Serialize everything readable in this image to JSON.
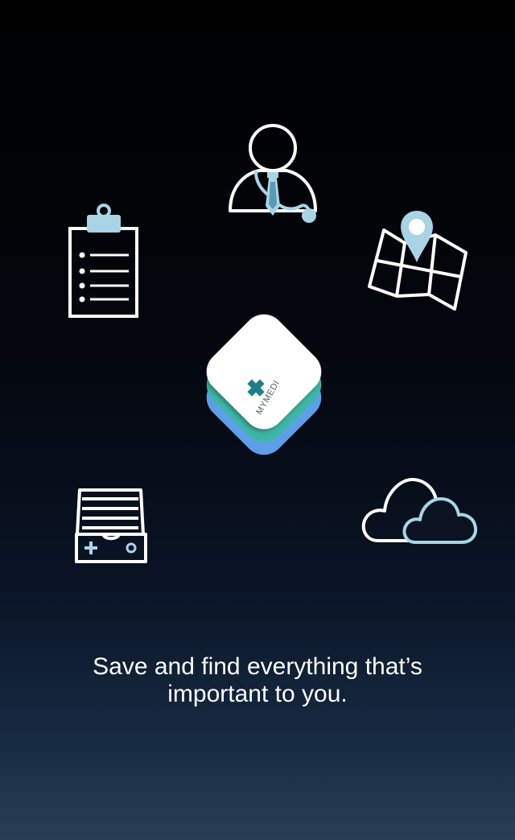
{
  "app": {
    "logo_text": "MYMEDI"
  },
  "icons": {
    "doctor": "doctor-icon",
    "clipboard": "clipboard-checklist-icon",
    "map": "map-pin-icon",
    "drawer": "medical-drawer-icon",
    "cloud": "cloud-icon",
    "logo": "app-logo-icon"
  },
  "colors": {
    "accent_light_blue": "#a8d4e6",
    "logo_teal": "#3eb5a6",
    "logo_blue": "#5d9fe6",
    "cross_teal": "#1f7f86"
  },
  "tagline": {
    "line1": "Save and find everything that’s",
    "line2": "important to you."
  }
}
